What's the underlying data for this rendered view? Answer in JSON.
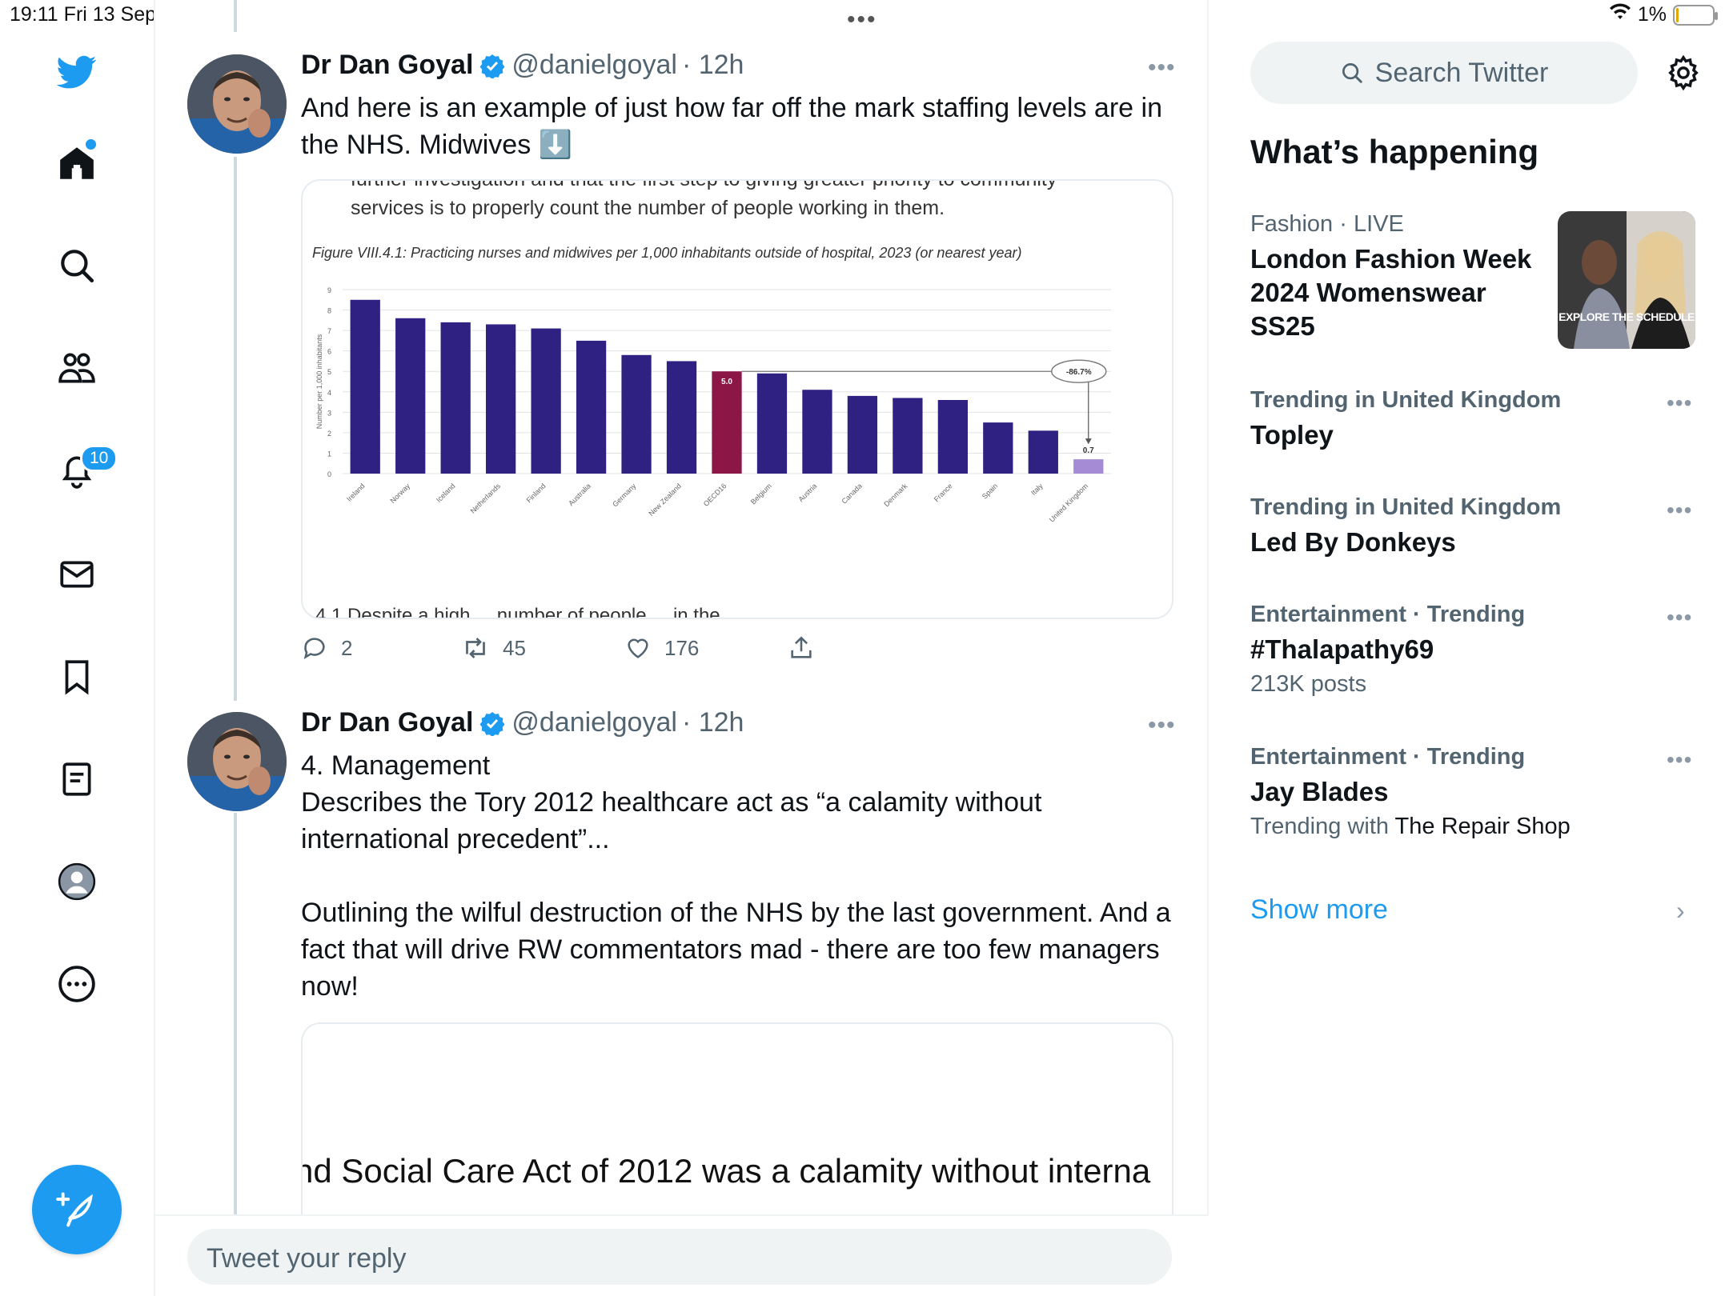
{
  "status": {
    "time": "19:11",
    "date": "Fri 13 Sep",
    "battery": "1%",
    "multitask": "•••"
  },
  "nav": {
    "notifications_badge": "10"
  },
  "tweets": [
    {
      "name": "Dr Dan Goyal",
      "handle": "@danielgoyal",
      "time": "· 12h",
      "more": "•••",
      "text": "And here is an example of just how far off the mark staffing levels are in the NHS. Midwives ⬇️",
      "media": {
        "top_text_1": "further investigation and that the first step to giving greater priority to community",
        "top_text_2": "services is to properly count the number of people working in them.",
        "figure_caption": "Figure VIII.4.1: Practicing nurses and midwives per 1,000 inhabitants outside of hospital, 2023 (or nearest year)",
        "bottom_cut_text": "4.1 Despite a high ... number of people ... in the"
      },
      "actions": {
        "replies": "2",
        "retweets": "45",
        "likes": "176"
      }
    },
    {
      "name": "Dr Dan Goyal",
      "handle": "@danielgoyal",
      "time": "· 12h",
      "more": "•••",
      "text": "4. Management\nDescribes the Tory 2012 healthcare act as “a calamity without international precedent”...\n\nOutlining the wilful destruction of the NHS by the last government. And a fact that will drive RW commentators mad - there are too few managers now!",
      "media": {
        "visible_text": "nd Social Care Act of 2012 was a calamity without interna"
      }
    }
  ],
  "chart_data": {
    "type": "bar",
    "title": "Figure VIII.4.1: Practicing nurses and midwives per 1,000 inhabitants outside of hospital, 2023 (or nearest year)",
    "xlabel": "",
    "ylabel": "Number per 1,000 inhabitants",
    "ylim": [
      0,
      9
    ],
    "yticks": [
      "0",
      "1",
      "2",
      "3",
      "4",
      "5",
      "6",
      "7",
      "8",
      "9"
    ],
    "categories": [
      "Ireland",
      "Norway",
      "Iceland",
      "Netherlands",
      "Finland",
      "Australia",
      "Germany",
      "New Zealand",
      "OECD16",
      "Belgium",
      "Austria",
      "Canada",
      "Denmark",
      "France",
      "Spain",
      "Italy",
      "United Kingdom"
    ],
    "values": [
      8.5,
      7.6,
      7.4,
      7.3,
      7.1,
      6.5,
      5.8,
      5.5,
      5.0,
      4.9,
      4.1,
      3.8,
      3.7,
      3.6,
      2.5,
      2.1,
      0.7
    ],
    "highlight": {
      "OECD16": "5.0",
      "United Kingdom": "0.7"
    },
    "annotation": "-86.7%",
    "colors": {
      "bar": "#2e2181",
      "oecd": "#8c1645",
      "uk": "#a58ad6"
    }
  },
  "reply": {
    "placeholder": "Tweet your reply"
  },
  "sidebar": {
    "search_placeholder": "Search Twitter",
    "title": "What’s happening",
    "trends": [
      {
        "context": "Fashion · LIVE",
        "topic": "London Fashion Week 2024 Womenswear SS25",
        "thumb_label": "EXPLORE THE SCHEDULE"
      },
      {
        "context": "Trending in United Kingdom",
        "topic": "Topley"
      },
      {
        "context": "Trending in United Kingdom",
        "topic": "Led By Donkeys"
      },
      {
        "context": "Entertainment · Trending",
        "topic": "#Thalapathy69",
        "sub": "213K posts"
      },
      {
        "context": "Entertainment · Trending",
        "topic": "Jay Blades",
        "sub_prefix": "Trending with ",
        "sub_link": "The Repair Shop"
      }
    ],
    "show_more": "Show more",
    "trend_dots": "•••",
    "chevron": "›"
  },
  "colors": {
    "accent": "#1d9bf0",
    "text": "#0f1419",
    "muted": "#536471"
  }
}
